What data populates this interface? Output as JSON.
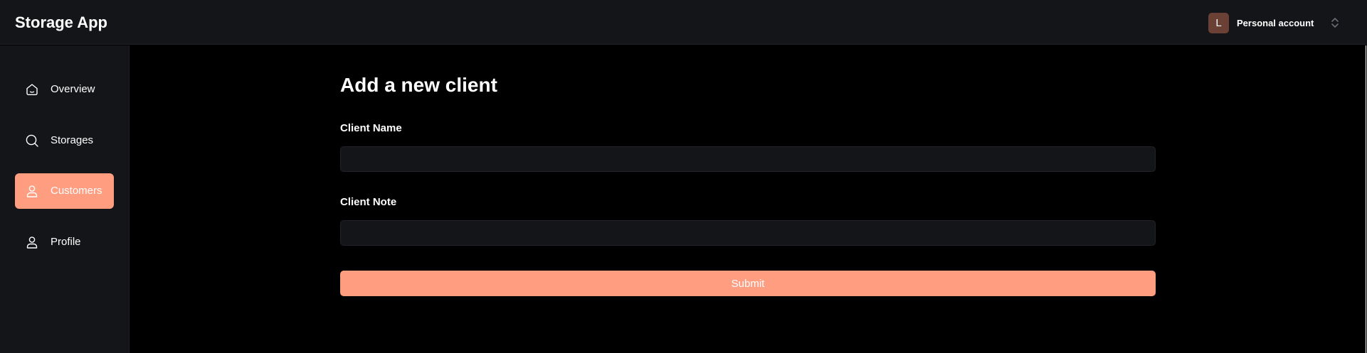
{
  "header": {
    "app_title": "Storage App",
    "account": {
      "avatar_initial": "L",
      "label": "Personal account",
      "avatar_color": "#6b4136"
    }
  },
  "sidebar": {
    "items": [
      {
        "label": "Overview",
        "icon": "home-icon",
        "active": false
      },
      {
        "label": "Storages",
        "icon": "search-icon",
        "active": false
      },
      {
        "label": "Customers",
        "icon": "user-icon",
        "active": true
      },
      {
        "label": "Profile",
        "icon": "user-icon",
        "active": false
      }
    ],
    "active_color": "#ff9d81"
  },
  "main": {
    "title": "Add a new client",
    "fields": [
      {
        "label": "Client Name",
        "value": "",
        "placeholder": ""
      },
      {
        "label": "Client Note",
        "value": "",
        "placeholder": ""
      }
    ],
    "submit_label": "Submit",
    "accent_color": "#ff9d81"
  }
}
